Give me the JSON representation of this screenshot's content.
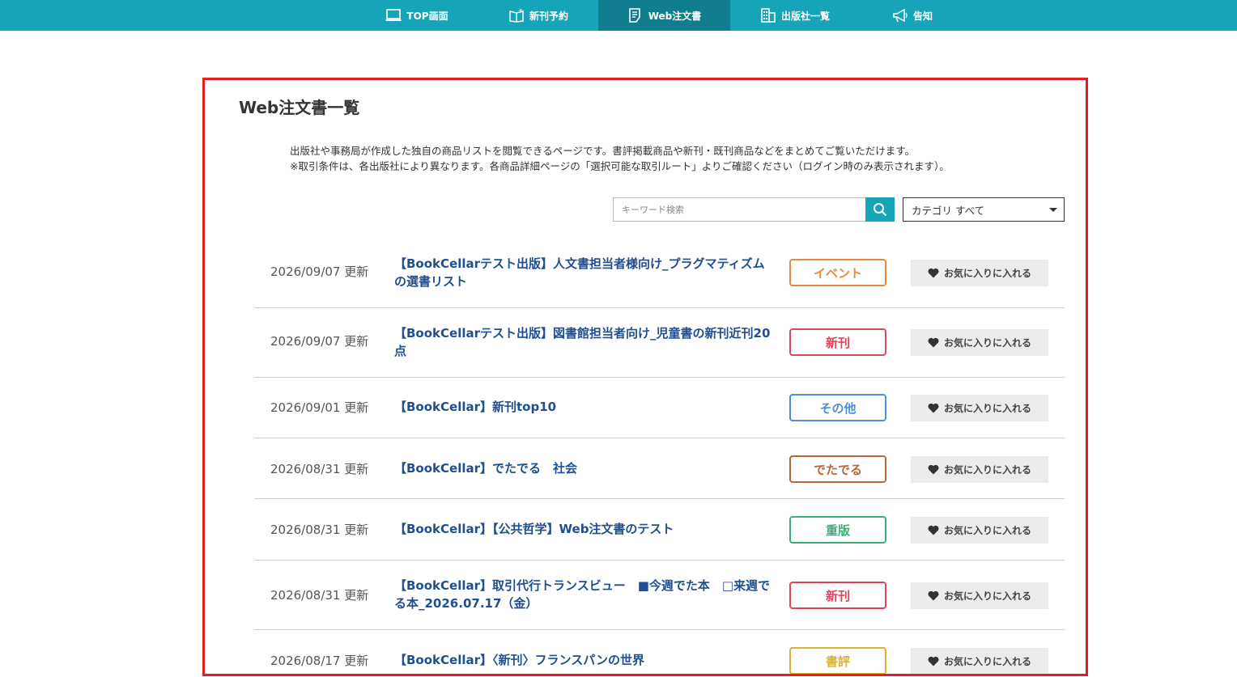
{
  "nav": {
    "items": [
      {
        "label": "TOP画面",
        "icon": "monitor-icon"
      },
      {
        "label": "新刊予約",
        "icon": "book-sparkle-icon"
      },
      {
        "label": "Web注文書",
        "icon": "document-icon"
      },
      {
        "label": "出版社一覧",
        "icon": "building-icon"
      },
      {
        "label": "告知",
        "icon": "megaphone-icon"
      }
    ],
    "active_index": 2
  },
  "page": {
    "title": "Web注文書一覧",
    "desc_line1": "出版社や事務局が作成した独自の商品リストを閲覧できるページです。書評掲載商品や新刊・既刊商品などをまとめてご覧いただけます。",
    "desc_line2": "※取引条件は、各出版社により異なります。各商品詳細ページの「選択可能な取引ルート」よりご確認ください（ログイン時のみ表示されます）。"
  },
  "search": {
    "placeholder": "キーワード検索",
    "value": ""
  },
  "category": {
    "selected": "カテゴリ すべて"
  },
  "fav_label": "お気に入りに入れる",
  "rows": [
    {
      "date": "2026/09/07 更新",
      "title": "【BookCellarテスト出版】人文書担当者様向け_プラグマティズムの選書リスト",
      "tag": "イベント",
      "tag_color": "#e8893a"
    },
    {
      "date": "2026/09/07 更新",
      "title": "【BookCellarテスト出版】図書館担当者向け_児童書の新刊近刊20点",
      "tag": "新刊",
      "tag_color": "#e0465a"
    },
    {
      "date": "2026/09/01 更新",
      "title": "【BookCellar】新刊top10",
      "tag": "その他",
      "tag_color": "#4a90d9"
    },
    {
      "date": "2026/08/31 更新",
      "title": "【BookCellar】でたでる　社会",
      "tag": "でたでる",
      "tag_color": "#b8683e"
    },
    {
      "date": "2026/08/31 更新",
      "title": "【BookCellar】【公共哲学】Web注文書のテスト",
      "tag": "重版",
      "tag_color": "#3cae78"
    },
    {
      "date": "2026/08/31 更新",
      "title": "【BookCellar】取引代行トランスビュー　■今週でた本　□来週でる本_2026.07.17（金）",
      "tag": "新刊",
      "tag_color": "#e0465a"
    },
    {
      "date": "2026/08/17 更新",
      "title": "【BookCellar】〈新刊〉フランスパンの世界",
      "tag": "書評",
      "tag_color": "#e0b030"
    }
  ],
  "colors": {
    "nav_bg": "#16a5b8",
    "nav_active": "#117e8f",
    "highlight_border": "#e0201f",
    "title_link": "#1f4f8f"
  }
}
